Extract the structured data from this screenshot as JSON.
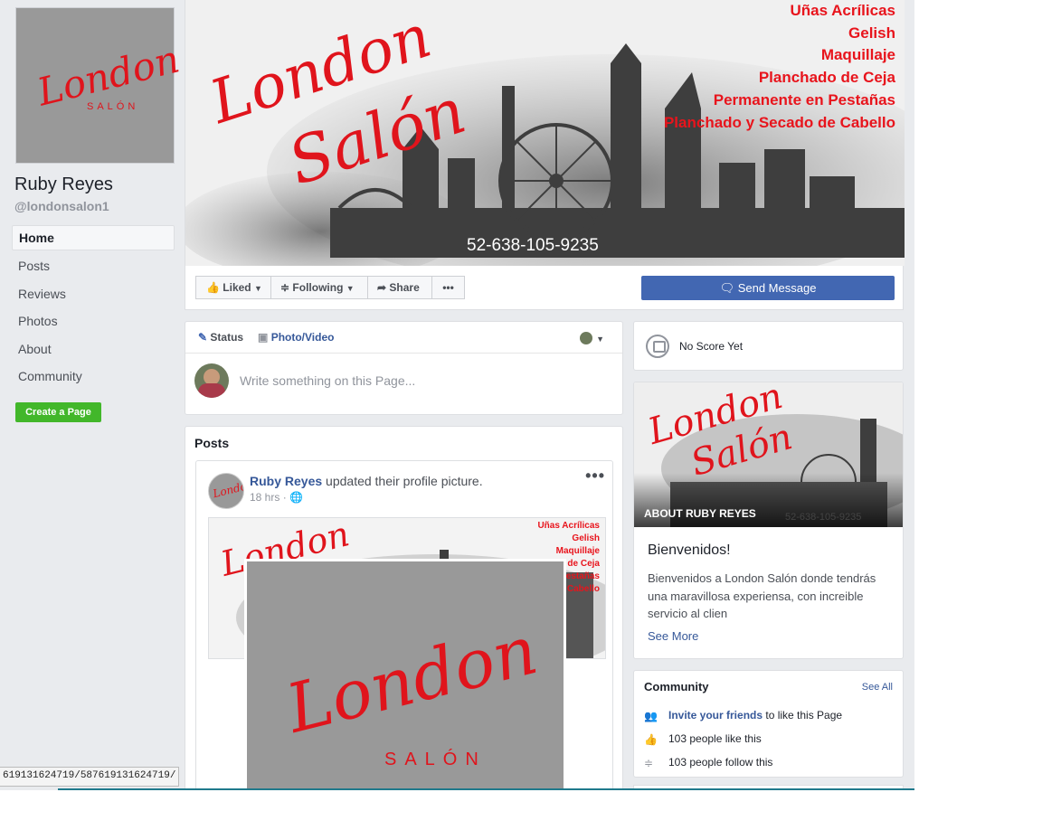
{
  "sidebar": {
    "profile_logo": {
      "script": "London",
      "sub": "SALÓN"
    },
    "page_name": "Ruby Reyes",
    "handle": "@londonsalon1",
    "nav": [
      "Home",
      "Posts",
      "Reviews",
      "Photos",
      "About",
      "Community"
    ],
    "create_page": "Create a Page",
    "url_tooltip": "619131624719/587619131624719/"
  },
  "cover": {
    "logo_line1": "London",
    "logo_line2": "Salón",
    "services": [
      "Uñas Acrílicas",
      "Gelish",
      "Maquillaje",
      "Planchado de Ceja",
      "Permanente en Pestañas",
      "Planchado y Secado de Cabello"
    ],
    "phone": "52-638-105-9235"
  },
  "actions": {
    "liked": "Liked",
    "following": "Following",
    "share": "Share",
    "more": "•••",
    "send_message": "Send Message"
  },
  "composer": {
    "status": "Status",
    "photo_video": "Photo/Video",
    "placeholder": "Write something on this Page..."
  },
  "posts": {
    "title": "Posts",
    "post": {
      "author": "Ruby Reyes",
      "action": "updated their profile picture.",
      "time": "18 hrs",
      "more": "•••",
      "cover_services": [
        "Uñas Acrílicas",
        "Gelish",
        "Maquillaje",
        "de Ceja",
        "estañas",
        "Cabello"
      ],
      "profile_logo": {
        "script": "London",
        "sub": "SALÓN"
      }
    }
  },
  "right": {
    "score": "No Score Yet",
    "about": {
      "image_label": "ABOUT RUBY REYES",
      "image_phone": "52-638-105-9235",
      "logo_line1": "London",
      "logo_line2": "Salón",
      "title": "Bienvenidos!",
      "text": "Bienvenidos a London Salón donde tendrás una maravillosa experiensa, con increible servicio al clien",
      "see_more": "See More"
    },
    "community": {
      "title": "Community",
      "see_all": "See All",
      "invite_link": "Invite your friends",
      "invite_rest": " to like this Page",
      "likes": "103 people like this",
      "follows": "103 people follow this"
    }
  },
  "colors": {
    "accent_blue": "#4267b2",
    "link": "#365899",
    "brand_red": "#e0141c",
    "green": "#42b72a"
  }
}
